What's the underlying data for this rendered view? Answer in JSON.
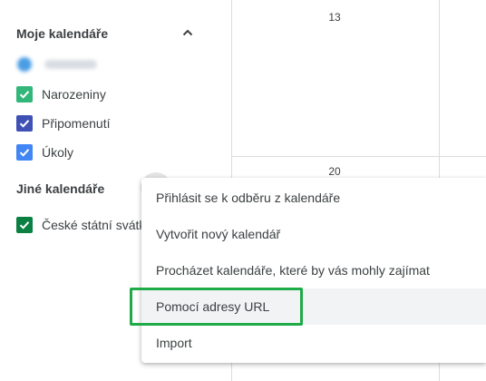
{
  "sidebar": {
    "my_calendars": {
      "title": "Moje kalendáře",
      "items": [
        {
          "label": "Narozeniny",
          "color": "#33b679"
        },
        {
          "label": "Připomenutí",
          "color": "#3f51b5"
        },
        {
          "label": "Úkoly",
          "color": "#4285f4"
        }
      ]
    },
    "other_calendars": {
      "title": "Jiné kalendáře",
      "items": [
        {
          "label": "České státní svátk",
          "color": "#0b8043"
        }
      ]
    }
  },
  "grid": {
    "day_numbers": [
      "13",
      "20"
    ]
  },
  "menu": {
    "items": [
      {
        "label": "Přihlásit se k odběru z kalendáře"
      },
      {
        "label": "Vytvořit nový kalendář"
      },
      {
        "label": "Procházet kalendáře, které by vás mohly zajímat"
      },
      {
        "label": "Pomocí adresy URL"
      },
      {
        "label": "Import"
      }
    ]
  },
  "colors": {
    "annotation_box": "#1faa48",
    "menu_hover": "#f1f3f4"
  }
}
